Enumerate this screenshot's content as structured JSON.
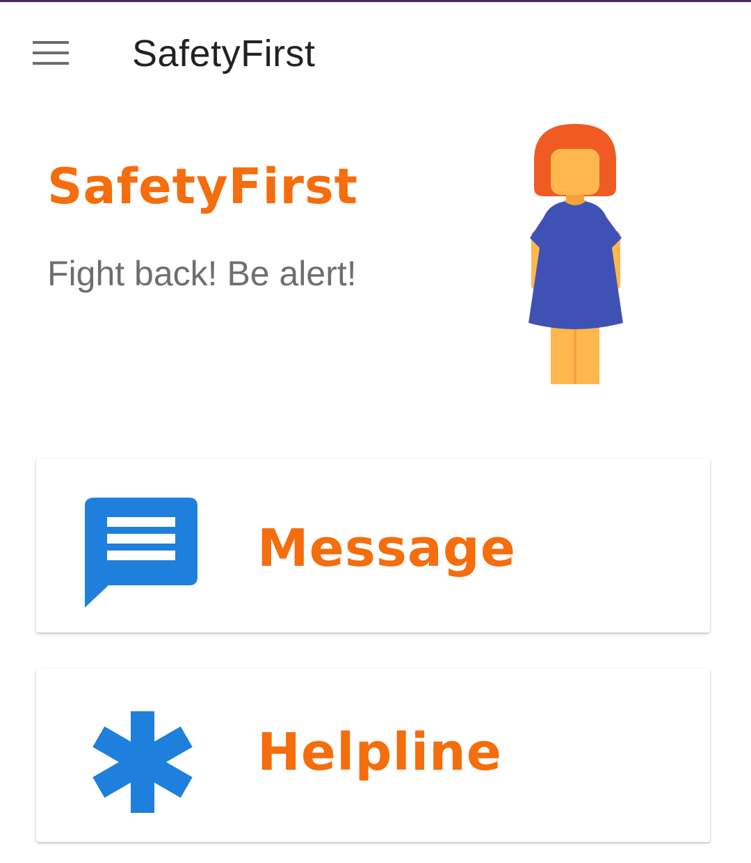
{
  "app_bar": {
    "title": "SafetyFirst",
    "menu_icon": "hamburger-menu-icon"
  },
  "hero": {
    "title": "SafetyFirst",
    "tagline": "Fight back! Be alert!",
    "illustration_icon": "woman-illustration-icon"
  },
  "cards": {
    "message": {
      "label": "Message",
      "icon": "message-icon"
    },
    "helpline": {
      "label": "Helpline",
      "icon": "asterisk-icon"
    }
  },
  "colors": {
    "accent": "#f56d0c",
    "icon_blue": "#1e7fdc",
    "status_bar": "#4a2a5e",
    "tagline": "#6e6e6e"
  }
}
